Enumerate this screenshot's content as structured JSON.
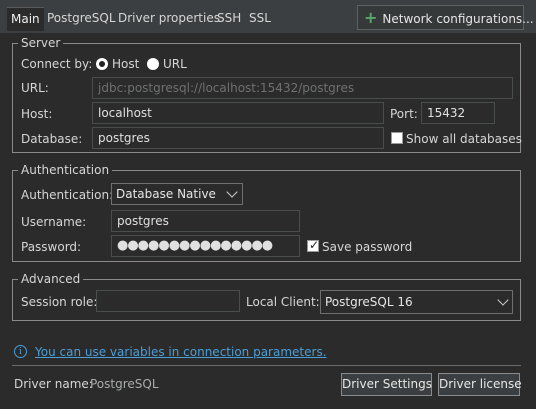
{
  "tabs": [
    {
      "label": "Main",
      "active": true
    },
    {
      "label": "PostgreSQL"
    },
    {
      "label": "Driver properties"
    },
    {
      "label": "SSH"
    },
    {
      "label": "SSL"
    }
  ],
  "network_button": {
    "icon": "plus-icon",
    "label": "Network configurations..."
  },
  "server": {
    "title": "Server",
    "connect_by_label": "Connect by:",
    "options": {
      "host": "Host",
      "url": "URL"
    },
    "selected": "Host",
    "url_label": "URL:",
    "url_value": "jdbc:postgresql://localhost:15432/postgres",
    "host_label": "Host:",
    "host_value": "localhost",
    "port_label": "Port:",
    "port_value": "15432",
    "database_label": "Database:",
    "database_value": "postgres",
    "show_all_label": "Show all databases",
    "show_all_checked": false
  },
  "auth": {
    "title": "Authentication",
    "auth_label": "Authentication:",
    "auth_value": "Database Native",
    "username_label": "Username:",
    "username_value": "postgres",
    "password_label": "Password:",
    "password_value": "●●●●●●●●●●●●●●●",
    "save_password_label": "Save password",
    "save_password_checked": true
  },
  "advanced": {
    "title": "Advanced",
    "session_role_label": "Session role:",
    "session_role_value": "",
    "local_client_label": "Local Client:",
    "local_client_value": "PostgreSQL 16"
  },
  "info_link": "You can use variables in connection parameters.",
  "footer": {
    "driver_name_label": "Driver name:",
    "driver_name_value": "PostgreSQL",
    "driver_settings_button": "Driver Settings",
    "driver_license_button": "Driver license"
  },
  "colors": {
    "accent_link": "#4a9fd8",
    "plus_green": "#59a869",
    "background": "#2b2b2b"
  }
}
